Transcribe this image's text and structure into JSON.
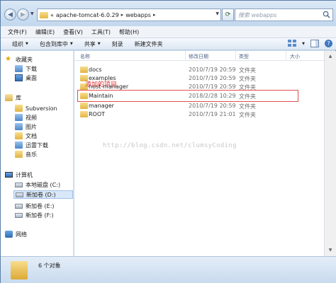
{
  "address": {
    "crumbs": [
      "apache-tomcat-6.0.29",
      "webapps"
    ],
    "prefix": "«"
  },
  "search": {
    "placeholder": "搜索 webapps"
  },
  "menu": [
    "文件(F)",
    "编辑(E)",
    "查看(V)",
    "工具(T)",
    "帮助(H)"
  ],
  "toolbar": {
    "organize": "组织",
    "include": "包含到库中",
    "share": "共享",
    "burn": "刻录",
    "new_folder": "新建文件夹"
  },
  "sidebar": {
    "favorites": "收藏夹",
    "downloads": "下载",
    "desktop": "桌面",
    "library": "库",
    "subversion": "Subversion",
    "videos": "视频",
    "pictures": "图片",
    "documents": "文档",
    "thunder": "迅雷下载",
    "music": "音乐",
    "computer": "计算机",
    "drive_c": "本地磁盘 (C:)",
    "drive_d": "新加卷 (D:)",
    "drive_e": "新加卷 (E:)",
    "drive_f": "新加卷 (F:)",
    "network": "网络"
  },
  "columns": {
    "name": "名称",
    "date": "修改日期",
    "type": "类型",
    "size": "大小"
  },
  "files": [
    {
      "name": "docs",
      "date": "2010/7/19 20:59",
      "type": "文件夹"
    },
    {
      "name": "examples",
      "date": "2010/7/19 20:59",
      "type": "文件夹"
    },
    {
      "name": "host-manager",
      "date": "2010/7/19 20:59",
      "type": "文件夹"
    },
    {
      "name": "Maintain",
      "date": "2018/2/28 10:29",
      "type": "文件夹"
    },
    {
      "name": "manager",
      "date": "2010/7/19 20:59",
      "type": "文件夹"
    },
    {
      "name": "ROOT",
      "date": "2010/7/19 21:01",
      "type": "文件夹"
    }
  ],
  "annotation": "添加的项目",
  "watermark": "http://blog.csdn.net/clumsyCoding",
  "status": {
    "count_text": "6 个对象"
  },
  "colors": {
    "highlight": "#e05050",
    "annotation": "#e03030"
  }
}
